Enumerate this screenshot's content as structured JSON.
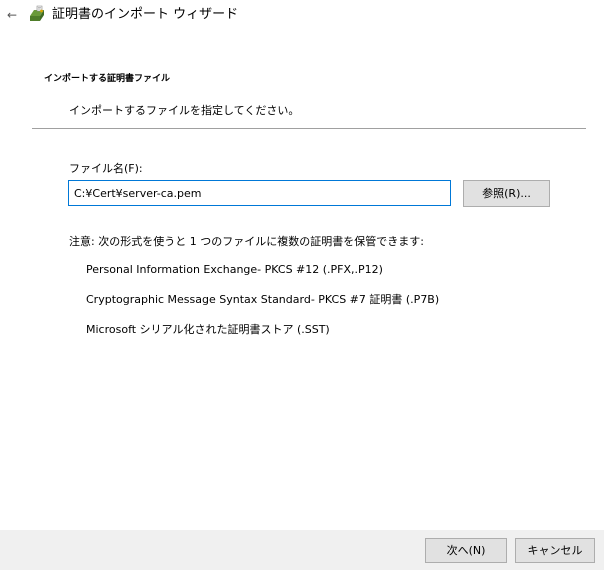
{
  "titlebar": {
    "back_glyph": "←",
    "icon": "certificate-wizard-icon",
    "title": "証明書のインポート ウィザード"
  },
  "section": {
    "heading": "インポートする証明書ファイル",
    "subheading": "インポートするファイルを指定してください。"
  },
  "file": {
    "label": "ファイル名(F):",
    "value": "C:¥Cert¥server-ca.pem",
    "browse_label": "参照(R)..."
  },
  "note": {
    "text": "注意: 次の形式を使うと 1 つのファイルに複数の証明書を保管できます:",
    "formats": [
      "Personal Information Exchange- PKCS #12 (.PFX,.P12)",
      "Cryptographic Message Syntax Standard- PKCS #7 証明書 (.P7B)",
      "Microsoft シリアル化された証明書ストア (.SST)"
    ]
  },
  "footer": {
    "next_label": "次へ(N)",
    "cancel_label": "キャンセル"
  }
}
